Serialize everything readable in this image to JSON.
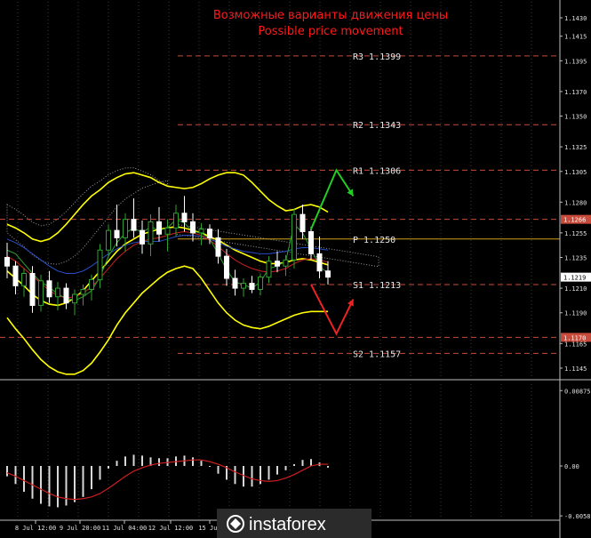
{
  "chart_data": [
    {
      "type": "candlestick",
      "title": "Возможные варианты движения цены",
      "subtitle": "Possible price movement",
      "ylim": [
        1.1137,
        1.1443
      ],
      "y_ticks": [
        "1.1430",
        "1.1415",
        "1.1395",
        "1.1370",
        "1.1350",
        "1.1325",
        "1.1305",
        "1.1280",
        "1.1255",
        "1.1235",
        "1.1210",
        "1.1190",
        "1.1165",
        "1.1145"
      ],
      "x_ticks": [
        "8 Jul 12:00",
        "9 Jul 20:00",
        "11 Jul 04:00",
        "12 Jul 12:00",
        "15 Jul"
      ],
      "current_price": "1.1219",
      "levels": [
        {
          "name": "R3",
          "value": 1.1399,
          "label": "R3  1.1399",
          "color": "#c84a3a"
        },
        {
          "name": "R2",
          "value": 1.1343,
          "label": "R2  1.1343",
          "color": "#c84a3a"
        },
        {
          "name": "R1",
          "value": 1.1306,
          "label": "R1  1.1306",
          "color": "#c84a3a"
        },
        {
          "name": "P",
          "value": 1.125,
          "label": "P  1.1250",
          "color": "#d4a017"
        },
        {
          "name": "S1",
          "value": 1.1213,
          "label": "S1  1.1213",
          "color": "#c84a3a"
        },
        {
          "name": "S2",
          "value": 1.1157,
          "label": "S2  1.1157",
          "color": "#c84a3a"
        }
      ],
      "marked_levels": [
        {
          "value": "1.1266",
          "color": "#c84a3a"
        },
        {
          "value": "1.1170",
          "color": "#c84a3a"
        }
      ],
      "candles": [
        {
          "o": 1.1235,
          "h": 1.1247,
          "l": 1.1218,
          "c": 1.1228
        },
        {
          "o": 1.1228,
          "h": 1.1232,
          "l": 1.1205,
          "c": 1.1212
        },
        {
          "o": 1.1212,
          "h": 1.1226,
          "l": 1.1203,
          "c": 1.1222
        },
        {
          "o": 1.1222,
          "h": 1.1228,
          "l": 1.119,
          "c": 1.1196
        },
        {
          "o": 1.1196,
          "h": 1.1221,
          "l": 1.1191,
          "c": 1.1216
        },
        {
          "o": 1.1216,
          "h": 1.1224,
          "l": 1.1198,
          "c": 1.1203
        },
        {
          "o": 1.1203,
          "h": 1.1215,
          "l": 1.1192,
          "c": 1.121
        },
        {
          "o": 1.121,
          "h": 1.1214,
          "l": 1.1193,
          "c": 1.1198
        },
        {
          "o": 1.1198,
          "h": 1.1209,
          "l": 1.1188,
          "c": 1.1205
        },
        {
          "o": 1.1205,
          "h": 1.1213,
          "l": 1.1196,
          "c": 1.1209
        },
        {
          "o": 1.1209,
          "h": 1.1221,
          "l": 1.12,
          "c": 1.1217
        },
        {
          "o": 1.1217,
          "h": 1.1246,
          "l": 1.121,
          "c": 1.1241
        },
        {
          "o": 1.1241,
          "h": 1.1262,
          "l": 1.1235,
          "c": 1.1257
        },
        {
          "o": 1.1257,
          "h": 1.1278,
          "l": 1.1244,
          "c": 1.1251
        },
        {
          "o": 1.1251,
          "h": 1.1271,
          "l": 1.124,
          "c": 1.1266
        },
        {
          "o": 1.1266,
          "h": 1.1283,
          "l": 1.1251,
          "c": 1.1257
        },
        {
          "o": 1.1257,
          "h": 1.1265,
          "l": 1.1238,
          "c": 1.1246
        },
        {
          "o": 1.1246,
          "h": 1.127,
          "l": 1.1236,
          "c": 1.1264
        },
        {
          "o": 1.1264,
          "h": 1.1276,
          "l": 1.1248,
          "c": 1.1254
        },
        {
          "o": 1.1254,
          "h": 1.1266,
          "l": 1.124,
          "c": 1.1259
        },
        {
          "o": 1.1259,
          "h": 1.1278,
          "l": 1.1252,
          "c": 1.1271
        },
        {
          "o": 1.1271,
          "h": 1.1285,
          "l": 1.1256,
          "c": 1.1264
        },
        {
          "o": 1.1264,
          "h": 1.1271,
          "l": 1.1248,
          "c": 1.1255
        },
        {
          "o": 1.1255,
          "h": 1.1263,
          "l": 1.1245,
          "c": 1.1258
        },
        {
          "o": 1.1258,
          "h": 1.1262,
          "l": 1.1246,
          "c": 1.1251
        },
        {
          "o": 1.1251,
          "h": 1.1258,
          "l": 1.123,
          "c": 1.1236
        },
        {
          "o": 1.1236,
          "h": 1.1242,
          "l": 1.1212,
          "c": 1.1218
        },
        {
          "o": 1.1218,
          "h": 1.1225,
          "l": 1.1204,
          "c": 1.121
        },
        {
          "o": 1.121,
          "h": 1.1218,
          "l": 1.1203,
          "c": 1.1214
        },
        {
          "o": 1.1214,
          "h": 1.122,
          "l": 1.1206,
          "c": 1.1209
        },
        {
          "o": 1.1209,
          "h": 1.1222,
          "l": 1.1204,
          "c": 1.1219
        },
        {
          "o": 1.1219,
          "h": 1.1236,
          "l": 1.1214,
          "c": 1.1232
        },
        {
          "o": 1.1232,
          "h": 1.124,
          "l": 1.1223,
          "c": 1.1228
        },
        {
          "o": 1.1228,
          "h": 1.1237,
          "l": 1.122,
          "c": 1.1233
        },
        {
          "o": 1.1233,
          "h": 1.1275,
          "l": 1.1226,
          "c": 1.127
        },
        {
          "o": 1.127,
          "h": 1.1278,
          "l": 1.125,
          "c": 1.1256
        },
        {
          "o": 1.1256,
          "h": 1.126,
          "l": 1.1233,
          "c": 1.1238
        },
        {
          "o": 1.1238,
          "h": 1.1252,
          "l": 1.1218,
          "c": 1.1224
        },
        {
          "o": 1.1224,
          "h": 1.1232,
          "l": 1.1213,
          "c": 1.1219
        }
      ],
      "series": [
        {
          "name": "",
          "color": "#ffff00",
          "values": [
            1.1262,
            1.1259,
            1.1255,
            1.125,
            1.1248,
            1.125,
            1.1255,
            1.1262,
            1.127,
            1.1278,
            1.1285,
            1.129,
            1.1296,
            1.13,
            1.1303,
            1.1304,
            1.1302,
            1.13,
            1.1296,
            1.1293,
            1.1292,
            1.1291,
            1.1292,
            1.1295,
            1.1299,
            1.1302,
            1.1304,
            1.1304,
            1.1302,
            1.1296,
            1.1289,
            1.1282,
            1.1277,
            1.1273,
            1.1274,
            1.1277,
            1.1278,
            1.1276,
            1.1272
          ]
        },
        {
          "name": "",
          "color": "#ffff00",
          "values": [
            1.1224,
            1.1218,
            1.1212,
            1.1205,
            1.12,
            1.1197,
            1.1196,
            1.1198,
            1.1202,
            1.1208,
            1.1216,
            1.1224,
            1.1232,
            1.124,
            1.1246,
            1.125,
            1.1254,
            1.1256,
            1.1258,
            1.1259,
            1.126,
            1.1259,
            1.1257,
            1.1255,
            1.1252,
            1.1249,
            1.1245,
            1.1241,
            1.1238,
            1.1235,
            1.1232,
            1.123,
            1.123,
            1.1231,
            1.1233,
            1.1234,
            1.1233,
            1.1231,
            1.1229
          ]
        },
        {
          "name": "",
          "color": "#ffff00",
          "values": [
            1.1186,
            1.1177,
            1.1169,
            1.116,
            1.1152,
            1.1146,
            1.1142,
            1.114,
            1.114,
            1.1143,
            1.1149,
            1.1158,
            1.1168,
            1.118,
            1.119,
            1.1198,
            1.1206,
            1.1212,
            1.1218,
            1.1223,
            1.1226,
            1.1228,
            1.1226,
            1.1218,
            1.1208,
            1.1198,
            1.119,
            1.1184,
            1.118,
            1.1178,
            1.1177,
            1.1179,
            1.1182,
            1.1185,
            1.1188,
            1.119,
            1.1191,
            1.1191,
            1.1191
          ]
        },
        {
          "name": "",
          "color": "#2a4cc7",
          "values": [
            1.125,
            1.1247,
            1.1243,
            1.1238,
            1.1233,
            1.1228,
            1.1224,
            1.1222,
            1.1222,
            1.1224,
            1.1228,
            1.1233,
            1.1238,
            1.1242,
            1.1245,
            1.1247,
            1.1248,
            1.1248,
            1.1248,
            1.125,
            1.1252,
            1.1253,
            1.1253,
            1.1252,
            1.125,
            1.1247,
            1.1244,
            1.1242,
            1.124,
            1.1239,
            1.1238,
            1.1238,
            1.1239,
            1.124,
            1.1242,
            1.1243,
            1.1243,
            1.1242,
            1.1241
          ]
        },
        {
          "name": "",
          "color": "#cc1f1f",
          "values": [
            1.1236,
            1.1232,
            1.1226,
            1.122,
            1.1214,
            1.1208,
            1.1204,
            1.1202,
            1.1203,
            1.1206,
            1.1211,
            1.1218,
            1.1226,
            1.1234,
            1.124,
            1.1245,
            1.1248,
            1.125,
            1.1251,
            1.1253,
            1.1255,
            1.1256,
            1.1255,
            1.1253,
            1.1249,
            1.1244,
            1.1238,
            1.1233,
            1.1229,
            1.1226,
            1.1224,
            1.1223,
            1.1224,
            1.1226,
            1.123,
            1.1233,
            1.1234,
            1.1233,
            1.1231
          ]
        },
        {
          "name": "",
          "color": "#2fa02f",
          "values": [
            1.1241,
            1.1238,
            1.123,
            1.1222,
            1.1215,
            1.1211,
            1.1205,
            1.1202,
            1.12,
            1.1203,
            1.1208,
            1.1219,
            1.1236,
            1.1247,
            1.1255,
            1.1259,
            1.1255,
            1.126,
            1.1257,
            1.1259,
            1.1266,
            1.1263,
            1.1256,
            1.1255,
            1.125,
            1.1238,
            1.1225,
            1.1215,
            1.1213,
            1.121,
            1.1215,
            1.1226,
            1.1228,
            1.1232,
            1.1262,
            1.1255,
            1.1242,
            1.1228,
            1.1222
          ]
        }
      ],
      "forecast": [
        {
          "name": "",
          "color": "#22cc22",
          "points": [
            [
              36,
              1.1258
            ],
            [
              39,
              1.1306
            ],
            [
              41,
              1.1285
            ]
          ]
        },
        {
          "name": "",
          "color": "#ee2222",
          "points": [
            [
              36,
              1.1213
            ],
            [
              39,
              1.1173
            ],
            [
              41,
              1.1201
            ]
          ]
        }
      ]
    },
    {
      "type": "histogram",
      "y_ticks": [
        "0.00875",
        "0.00",
        "-0.0058"
      ],
      "ylim": [
        -0.0062,
        0.0095
      ],
      "values": [
        -0.0012,
        -0.0021,
        -0.003,
        -0.0038,
        -0.0044,
        -0.0047,
        -0.0048,
        -0.0046,
        -0.0042,
        -0.0036,
        -0.0027,
        -0.0016,
        -0.0003,
        0.0006,
        0.0011,
        0.0013,
        0.0012,
        0.001,
        0.0009,
        0.0009,
        0.0011,
        0.0012,
        0.001,
        0.0006,
        -0.0001,
        -0.0009,
        -0.0016,
        -0.0021,
        -0.0024,
        -0.0024,
        -0.0021,
        -0.0016,
        -0.001,
        -0.0005,
        0.0002,
        0.0007,
        0.0008,
        0.0004,
        -0.0002
      ],
      "signal": {
        "name": "",
        "color": "#cc1f1f",
        "values": [
          -0.0008,
          -0.0012,
          -0.0017,
          -0.0022,
          -0.0027,
          -0.0032,
          -0.0036,
          -0.0038,
          -0.0039,
          -0.0038,
          -0.0036,
          -0.0032,
          -0.0026,
          -0.0019,
          -0.0012,
          -0.0006,
          -0.0002,
          0.0001,
          0.0003,
          0.0004,
          0.0005,
          0.0006,
          0.0007,
          0.0007,
          0.0005,
          0.0002,
          -0.0002,
          -0.0007,
          -0.0011,
          -0.0015,
          -0.0017,
          -0.0018,
          -0.0017,
          -0.0014,
          -0.001,
          -0.0005,
          0.0,
          0.0002,
          0.0002
        ]
      }
    }
  ],
  "branding": {
    "logo_text": "instaforex",
    "logo_icon": "instaforex-logo-icon"
  }
}
